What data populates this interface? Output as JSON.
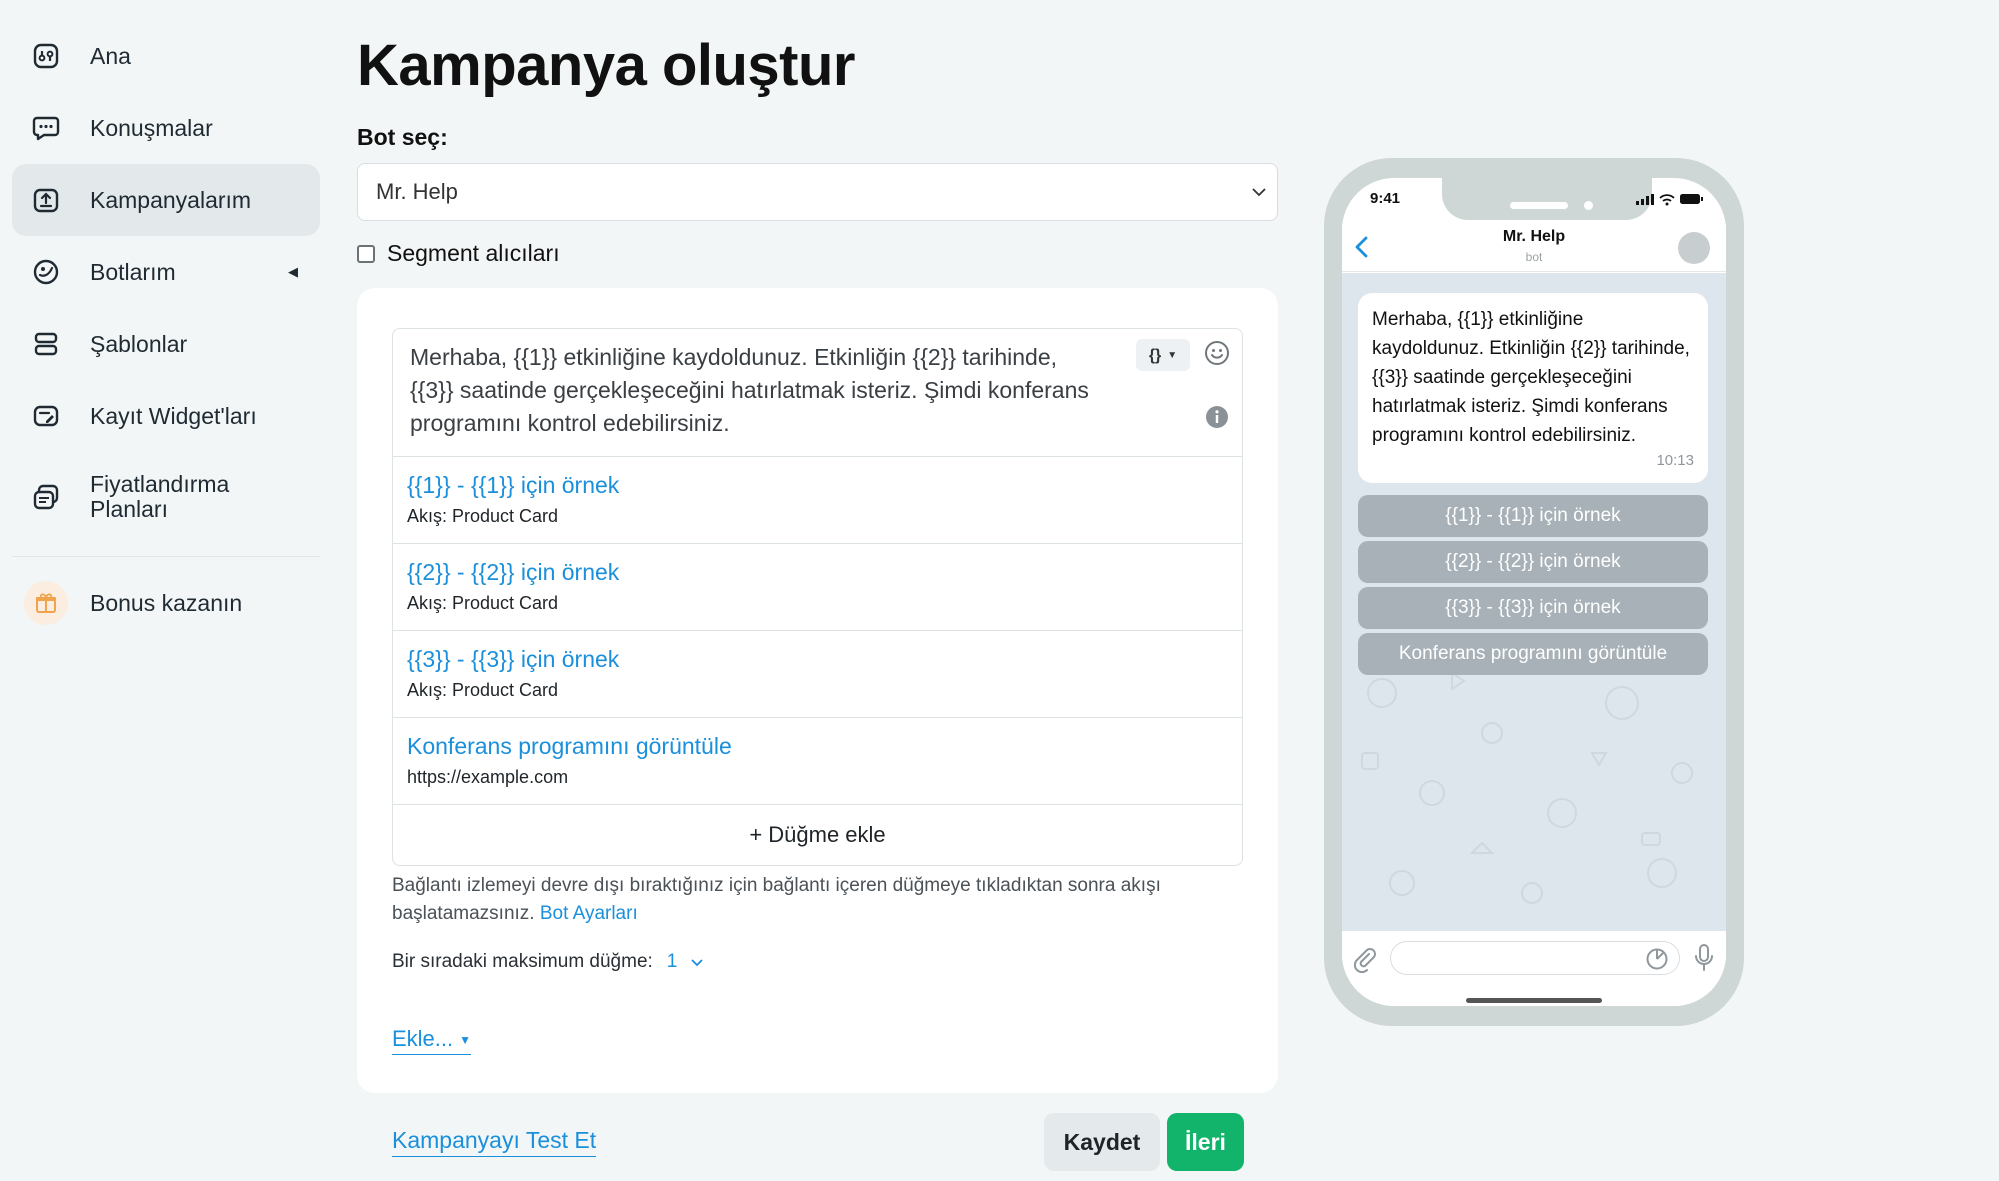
{
  "sidebar": {
    "items": [
      {
        "label": "Ana",
        "icon": "home-icon"
      },
      {
        "label": "Konuşmalar",
        "icon": "chat-icon"
      },
      {
        "label": "Kampanyalarım",
        "icon": "campaign-icon",
        "active": true
      },
      {
        "label": "Botlarım",
        "icon": "bot-icon"
      },
      {
        "label": "Şablonlar",
        "icon": "template-icon"
      },
      {
        "label": "Kayıt Widget'ları",
        "icon": "widget-icon"
      },
      {
        "label": "Fiyatlandırma Planları",
        "icon": "pricing-icon"
      }
    ],
    "bonus": {
      "label": "Bonus kazanın",
      "icon": "gift-icon"
    }
  },
  "page": {
    "title": "Kampanya oluştur",
    "bot_label": "Bot seç:",
    "bot_selected": "Mr. Help",
    "segment_label": "Segment alıcıları"
  },
  "editor": {
    "message": "Merhaba, {{1}} etkinliğine kaydoldunuz. Etkinliğin {{2}} tarihinde, {{3}} saatinde gerçekleşeceğini hatırlatmak isteriz. Şimdi konferans programını kontrol edebilirsiniz.",
    "variables_button": "{}",
    "buttons": [
      {
        "title": "{{1}} - {{1}} için örnek",
        "sub": "Akış: Product Card"
      },
      {
        "title": "{{2}} - {{2}} için örnek",
        "sub": "Akış: Product Card"
      },
      {
        "title": "{{3}} - {{3}} için örnek",
        "sub": "Akış: Product Card"
      },
      {
        "title": "Konferans programını görüntüle",
        "sub": "https://example.com"
      }
    ],
    "add_button": "+ Düğme ekle"
  },
  "hint": {
    "text": "Bağlantı izlemeyi devre dışı bıraktığınız için bağlantı içeren düğmeye tıkladıktan sonra akışı başlatamazsınız.",
    "link": "Bot Ayarları"
  },
  "max_buttons": {
    "label": "Bir sıradaki maksimum düğme:",
    "value": "1"
  },
  "add_menu": "Ekle...",
  "footer": {
    "test_link": "Kampanyayı Test Et",
    "save": "Kaydet",
    "next": "İleri"
  },
  "phone": {
    "time": "9:41",
    "chat_name": "Mr. Help",
    "chat_sub": "bot",
    "message_time": "10:13",
    "keyboard": [
      "{{1}} - {{1}} için örnek",
      "{{2}} - {{2}} için örnek",
      "{{3}} - {{3}} için örnek",
      "Konferans programını görüntüle"
    ]
  },
  "colors": {
    "accent": "#1a8fdb",
    "primary_button": "#12b36b",
    "sidebar_active": "#e3e9ea",
    "background": "#f3f6f6"
  }
}
